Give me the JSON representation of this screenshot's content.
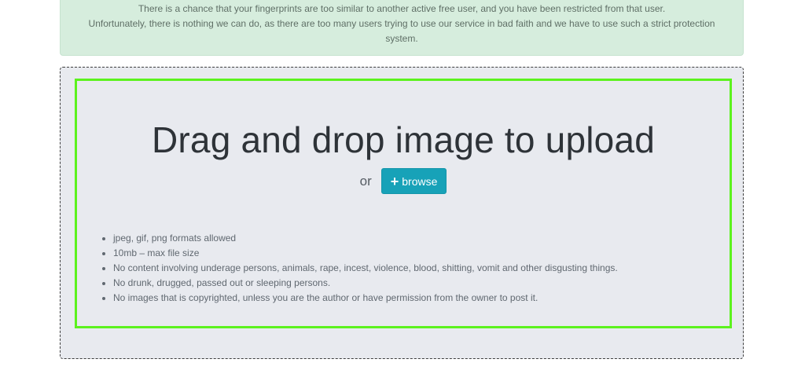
{
  "alert": {
    "line1": "There is a chance that your fingerprints are too similar to another active free user, and you have been restricted from that user.",
    "line2": "Unfortunately, there is nothing we can do, as there are too many users trying to use our service in bad faith and we have to use such a strict protection",
    "line3": "system."
  },
  "upload": {
    "title": "Drag and drop image to upload",
    "or_label": "or",
    "browse_icon": "+",
    "browse_label": "browse",
    "rules": [
      "jpeg, gif, png formats allowed",
      "10mb – max file size",
      "No content involving underage persons, animals, rape, incest, violence, blood, shitting, vomit and other disgusting things.",
      "No drunk, drugged, passed out or sleeping persons.",
      "No images that is copyrighted, unless you are the author or have permission from the owner to post it."
    ]
  },
  "colors": {
    "alert_bg": "#d6eddd",
    "dropzone_bg": "#e8eaef",
    "highlight_border": "#5cf21e",
    "button_bg": "#17a2b8"
  }
}
